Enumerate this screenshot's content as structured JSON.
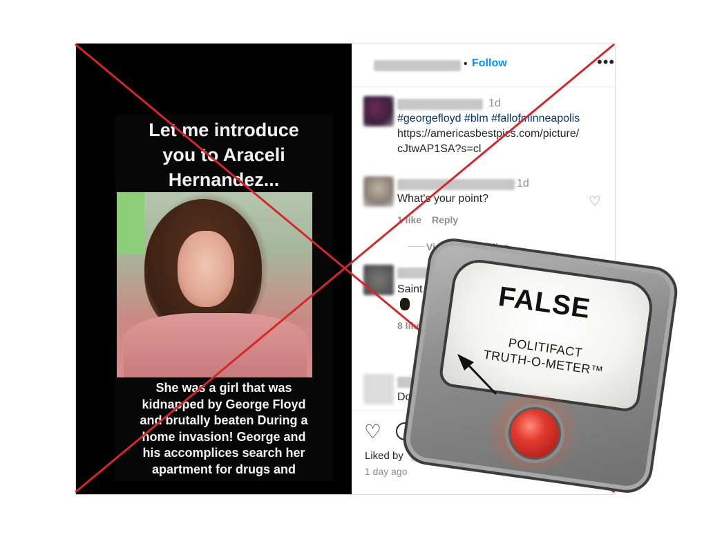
{
  "post": {
    "story_headline": "Let me introduce\nyou to Araceli\nHernandez...",
    "story_caption": "She was a girl that was\nkidnapped by George Floyd\nand brutally beaten During a\nhome invasion! George and\nhis accomplices search her\napartment for drugs and",
    "header": {
      "separator": "•",
      "follow_label": "Follow",
      "more_icon": "more-icon"
    },
    "comments": [
      {
        "time": "1d",
        "hashtags": "#georgefloyd #blm #fallofminneapolis",
        "link": "https://americasbestpics.com/picture/\ncJtwAP1SA?s=cl"
      },
      {
        "time": "1d",
        "text": "What's your point?",
        "likes": "1 like",
        "reply_label": "Reply",
        "view_replies": "View all 14 replies"
      },
      {
        "text": "Saint",
        "likes": "8 like"
      },
      {
        "text": "Doe"
      }
    ],
    "liked_by_label": "Liked by",
    "age": "1 day ago"
  },
  "overlay": {
    "x_color": "#d7262b"
  },
  "meter": {
    "verdict": "FALSE",
    "brand": "POLITIFACT\nTRUTH-O-METER™"
  },
  "colors": {
    "follow": "#0095f6",
    "hashtag": "#00376b",
    "muted": "#8e8e8e",
    "text": "#262626"
  }
}
